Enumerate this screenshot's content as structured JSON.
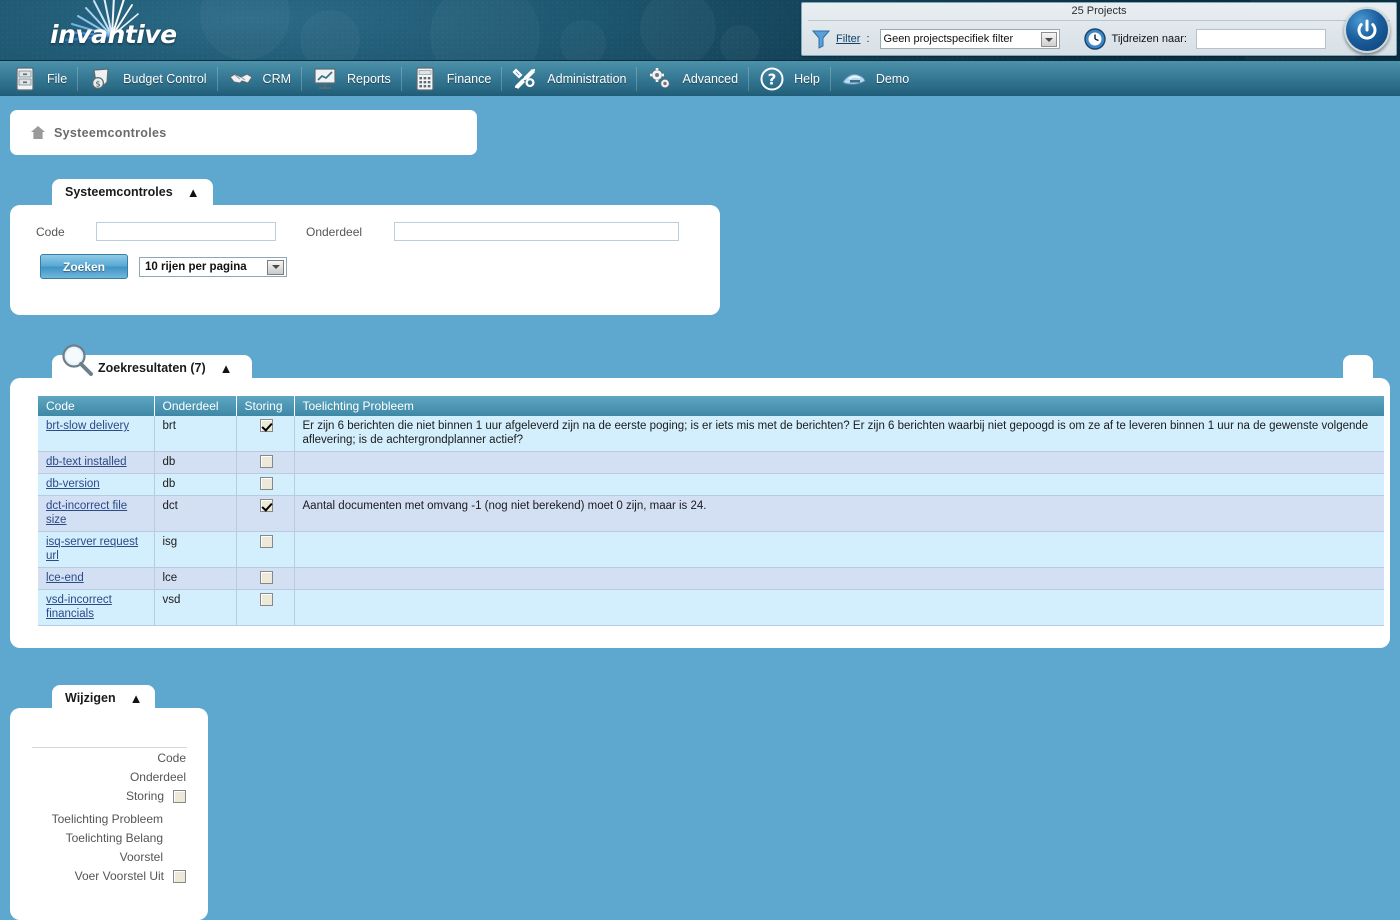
{
  "header": {
    "logo_text": "invantive",
    "logo_icon": "invantive-burst-logo"
  },
  "filter_bar": {
    "project_count": "25 Projects",
    "funnel_icon": "funnel-icon",
    "filter_label": "Filter",
    "filter_colon": ":",
    "filter_value": "Geen projectspecifiek filter",
    "filter_options": [
      "Geen projectspecifiek filter"
    ],
    "clock_icon": "clock-icon",
    "timetravel_label": "Tijdreizen naar:",
    "timetravel_value": "",
    "power_icon": "power-icon"
  },
  "menu": {
    "items": [
      {
        "label": "File",
        "icon": "cabinet-icon"
      },
      {
        "label": "Budget Control",
        "icon": "money-shield-icon"
      },
      {
        "label": "CRM",
        "icon": "handshake-icon"
      },
      {
        "label": "Reports",
        "icon": "presentation-chart-icon"
      },
      {
        "label": "Finance",
        "icon": "calculator-icon"
      },
      {
        "label": "Administration",
        "icon": "tools-icon"
      },
      {
        "label": "Advanced",
        "icon": "gears-icon"
      },
      {
        "label": "Help",
        "icon": "question-circle-icon"
      },
      {
        "label": "Demo",
        "icon": "demo-bird-icon"
      }
    ]
  },
  "breadcrumb": {
    "home_icon": "home-icon",
    "label": "Systeemcontroles"
  },
  "search_panel": {
    "tab_label": "Systeemcontroles",
    "collapse_icon": "chevron-up-icon",
    "code_label": "Code",
    "code_value": "",
    "onderdeel_label": "Onderdeel",
    "onderdeel_value": "",
    "search_button": "Zoeken",
    "rows_per_page": "10 rijen per pagina",
    "rows_options": [
      "10 rijen per pagina"
    ]
  },
  "results_panel": {
    "tab_label": "Zoekresultaten (7)",
    "magnifier_icon": "magnifier-icon",
    "collapse_icon": "chevron-up-icon",
    "columns": [
      "Code",
      "Onderdeel",
      "Storing",
      "Toelichting Probleem"
    ],
    "rows": [
      {
        "code": "brt-slow delivery",
        "onderdeel": "brt",
        "storing": true,
        "toelichting": "Er zijn 6 berichten die niet binnen 1 uur afgeleverd zijn na de eerste poging; is er iets mis met de berichten? Er zijn 6 berichten waarbij niet gepoogd is om ze af te leveren binnen 1 uur na de gewenste volgende aflevering; is de achtergrondplanner actief?"
      },
      {
        "code": "db-text installed",
        "onderdeel": "db",
        "storing": false,
        "toelichting": ""
      },
      {
        "code": "db-version",
        "onderdeel": "db",
        "storing": false,
        "toelichting": ""
      },
      {
        "code": "dct-incorrect file size",
        "onderdeel": "dct",
        "storing": true,
        "toelichting": "Aantal documenten met omvang -1 (nog niet berekend) moet 0 zijn, maar is 24."
      },
      {
        "code": "isq-server request url",
        "onderdeel": "isg",
        "storing": false,
        "toelichting": ""
      },
      {
        "code": "lce-end",
        "onderdeel": "lce",
        "storing": false,
        "toelichting": ""
      },
      {
        "code": "vsd-incorrect financials",
        "onderdeel": "vsd",
        "storing": false,
        "toelichting": ""
      }
    ]
  },
  "edit_panel": {
    "tab_label": "Wijzigen",
    "collapse_icon": "chevron-up-icon",
    "fields": [
      {
        "label": "Code",
        "type": "text"
      },
      {
        "label": "Onderdeel",
        "type": "text"
      },
      {
        "label": "Storing",
        "type": "checkbox",
        "checked": false
      },
      {
        "label": "Toelichting Probleem",
        "type": "text"
      },
      {
        "label": "Toelichting Belang",
        "type": "text"
      },
      {
        "label": "Voorstel",
        "type": "text"
      },
      {
        "label": "Voer Voorstel Uit",
        "type": "checkbox",
        "checked": false
      }
    ]
  },
  "colors": {
    "page_background": "#5ea8cf",
    "banner_dark": "#123f55",
    "menu_teal": "#3b7f9a",
    "table_header": "#4e97b4",
    "row_odd": "#d3e0f4",
    "row_even": "#d3eefc",
    "link": "#2b4a8a"
  }
}
